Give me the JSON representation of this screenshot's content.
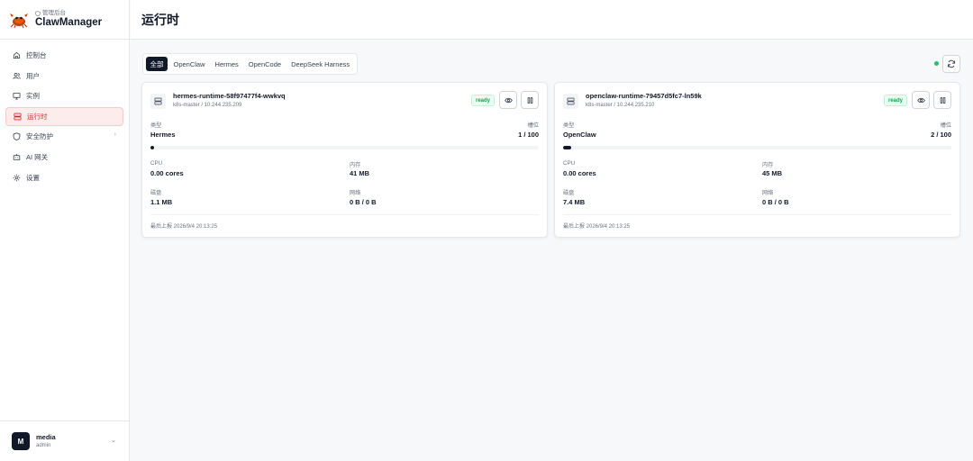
{
  "brand": {
    "subtitle": "管理后台",
    "title": "ClawManager",
    "logo_icon": "crab-logo-icon"
  },
  "sidebar": {
    "items": [
      {
        "label": "控制台",
        "icon": "home-icon"
      },
      {
        "label": "用户",
        "icon": "users-icon"
      },
      {
        "label": "实例",
        "icon": "monitor-icon"
      },
      {
        "label": "运行时",
        "icon": "server-icon",
        "active": true
      },
      {
        "label": "安全防护",
        "icon": "shield-icon",
        "has_children": true
      },
      {
        "label": "AI 网关",
        "icon": "bot-icon"
      },
      {
        "label": "设置",
        "icon": "gear-icon"
      }
    ]
  },
  "user": {
    "initial": "M",
    "name": "media",
    "role": "admin"
  },
  "header": {
    "title": "运行时"
  },
  "filters": {
    "tabs": [
      "全部",
      "OpenClaw",
      "Hermes",
      "OpenCode",
      "DeepSeek Harness"
    ],
    "active_index": 0
  },
  "status": {
    "online_color": "#22c55e"
  },
  "labels": {
    "type": "类型",
    "slots": "槽位",
    "cpu": "CPU",
    "memory": "内存",
    "disk": "磁盘",
    "network": "网络",
    "last_report_prefix": "最后上报"
  },
  "runtimes": [
    {
      "name": "hermes-runtime-58f97477f4-wwkvq",
      "node": "k8s-master / 10.244.235.209",
      "status": "ready",
      "type": "Hermes",
      "slots": "1 / 100",
      "slots_used": 1,
      "slots_total": 100,
      "cpu": "0.00 cores",
      "memory": "41 MB",
      "disk": "1.1 MB",
      "network": "0 B / 0 B",
      "last_report": "最后上报 2026/9/4 20:13:25"
    },
    {
      "name": "openclaw-runtime-79457d5fc7-ln59k",
      "node": "k8s-master / 10.244.235.210",
      "status": "ready",
      "type": "OpenClaw",
      "slots": "2 / 100",
      "slots_used": 2,
      "slots_total": 100,
      "cpu": "0.00 cores",
      "memory": "45 MB",
      "disk": "7.4 MB",
      "network": "0 B / 0 B",
      "last_report": "最后上报 2026/9/4 20:13:25"
    }
  ],
  "colors": {
    "accent_active": "#dc2626",
    "dark": "#111827",
    "ready": "#16a34a"
  }
}
